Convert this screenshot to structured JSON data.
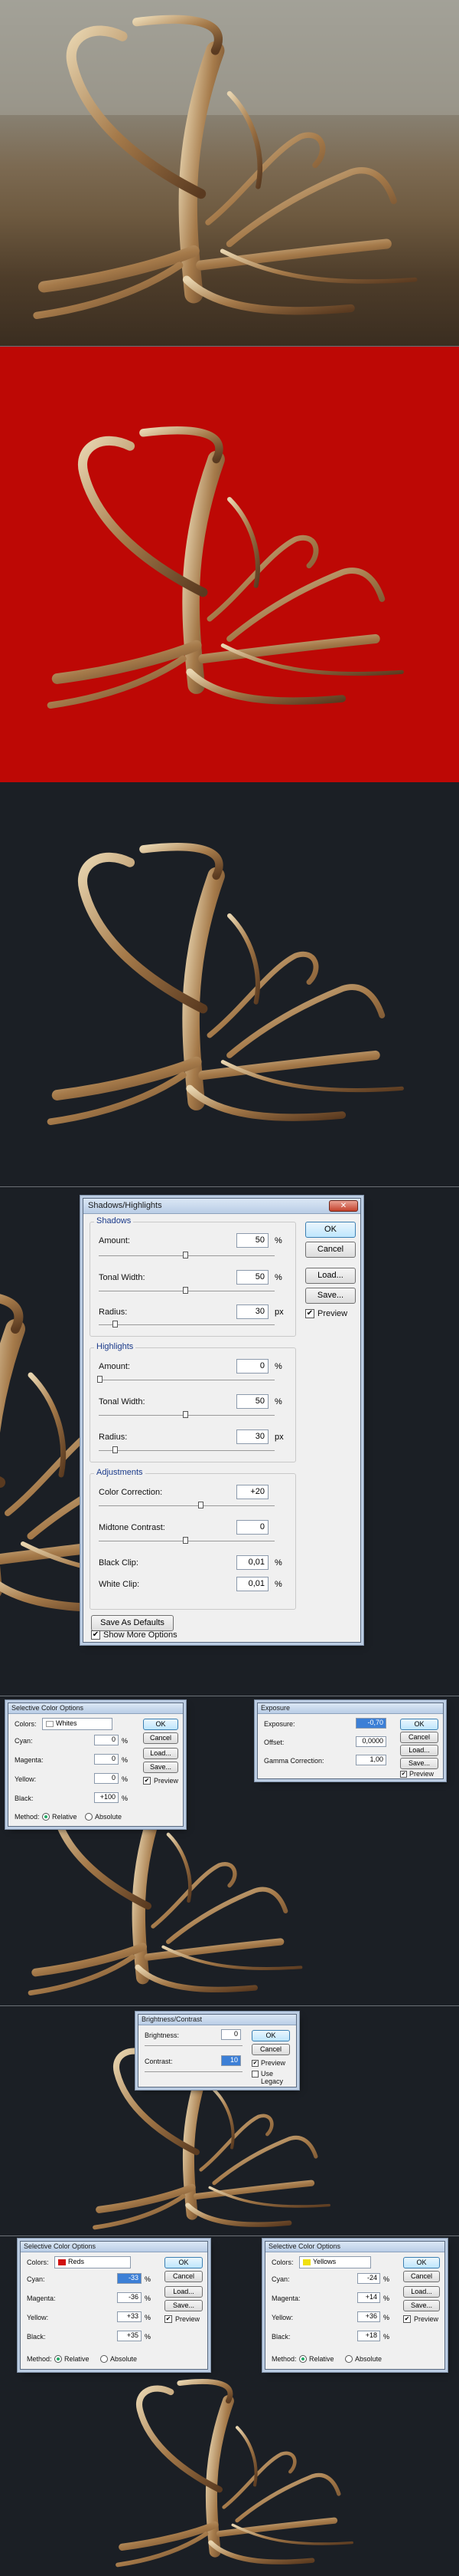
{
  "colors": {
    "red_bg": "#bd0805",
    "dark_bg": "#1b1f25"
  },
  "shadows_highlights": {
    "title": "Shadows/Highlights",
    "shadows": {
      "group": "Shadows",
      "amount_label": "Amount:",
      "amount": "50",
      "tonal_label": "Tonal Width:",
      "tonal": "50",
      "radius_label": "Radius:",
      "radius": "30"
    },
    "highlights": {
      "group": "Highlights",
      "amount_label": "Amount:",
      "amount": "0",
      "tonal_label": "Tonal Width:",
      "tonal": "50",
      "radius_label": "Radius:",
      "radius": "30"
    },
    "adjustments": {
      "group": "Adjustments",
      "color_label": "Color Correction:",
      "color": "+20",
      "midtone_label": "Midtone Contrast:",
      "midtone": "0",
      "black_label": "Black Clip:",
      "black": "0,01",
      "white_label": "White Clip:",
      "white": "0,01"
    },
    "unit_pct": "%",
    "unit_px": "px",
    "ok": "OK",
    "cancel": "Cancel",
    "load": "Load...",
    "save": "Save...",
    "preview": "Preview",
    "save_defaults": "Save As Defaults",
    "more_options": "Show More Options"
  },
  "selective_color_1": {
    "title": "Selective Color Options",
    "colors_label": "Colors:",
    "colors_value": "Whites",
    "cyan_label": "Cyan:",
    "cyan": "0",
    "magenta_label": "Magenta:",
    "magenta": "0",
    "yellow_label": "Yellow:",
    "yellow": "0",
    "black_label": "Black:",
    "black": "+100",
    "method_label": "Method:",
    "relative": "Relative",
    "absolute": "Absolute",
    "ok": "OK",
    "cancel": "Cancel",
    "load": "Load...",
    "save": "Save...",
    "preview": "Preview"
  },
  "exposure": {
    "title": "Exposure",
    "exposure_label": "Exposure:",
    "exposure": "-0,70",
    "offset_label": "Offset:",
    "offset": "0,0000",
    "gamma_label": "Gamma Correction:",
    "gamma": "1,00",
    "ok": "OK",
    "cancel": "Cancel",
    "load": "Load...",
    "save": "Save...",
    "preview": "Preview"
  },
  "brightness_contrast": {
    "title": "Brightness/Contrast",
    "brightness_label": "Brightness:",
    "brightness": "0",
    "contrast_label": "Contrast:",
    "contrast": "10",
    "ok": "OK",
    "cancel": "Cancel",
    "preview": "Preview",
    "legacy": "Use Legacy"
  },
  "selective_color_reds": {
    "title": "Selective Color Options",
    "colors_label": "Colors:",
    "colors_value": "Reds",
    "cyan_label": "Cyan:",
    "cyan": "-33",
    "magenta_label": "Magenta:",
    "magenta": "-36",
    "yellow_label": "Yellow:",
    "yellow": "+33",
    "black_label": "Black:",
    "black": "+35",
    "method_label": "Method:",
    "relative": "Relative",
    "absolute": "Absolute",
    "ok": "OK",
    "cancel": "Cancel",
    "load": "Load...",
    "save": "Save...",
    "preview": "Preview"
  },
  "selective_color_yellows": {
    "title": "Selective Color Options",
    "colors_label": "Colors:",
    "colors_value": "Yellows",
    "cyan_label": "Cyan:",
    "cyan": "-24",
    "magenta_label": "Magenta:",
    "magenta": "+14",
    "yellow_label": "Yellow:",
    "yellow": "+36",
    "black_label": "Black:",
    "black": "+18",
    "method_label": "Method:",
    "relative": "Relative",
    "absolute": "Absolute",
    "ok": "OK",
    "cancel": "Cancel",
    "load": "Load...",
    "save": "Save...",
    "preview": "Preview"
  }
}
